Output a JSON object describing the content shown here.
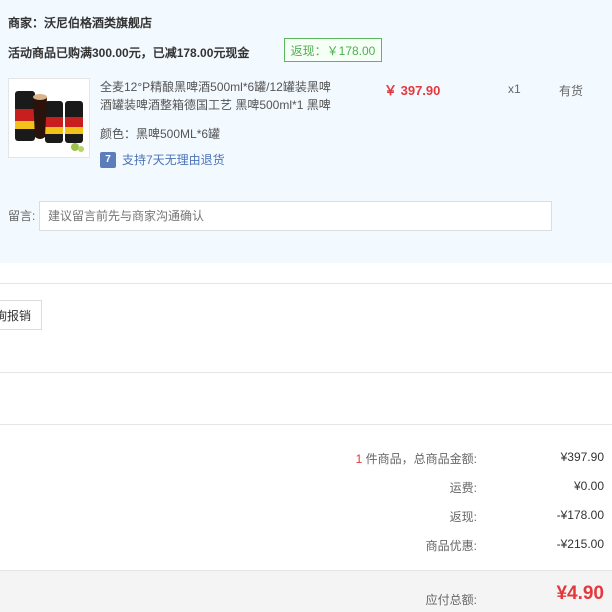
{
  "order": {
    "seller_prefix": "商家：",
    "seller_name": "沃尼伯格酒类旗舰店",
    "promo_text": "活动商品已购满300.00元，已减178.00元现金",
    "cashback_tag": "返现：￥178.00",
    "item": {
      "image_icon": "beer-can-pack",
      "title": "全麦12°P精酿黑啤酒500ml*6罐/12罐装黑啤酒罐装啤酒整箱德国工艺 黑啤500ml*1 黑啤",
      "price": "￥ 397.90",
      "quantity": "x1",
      "stock": "有货",
      "color": "颜色：黑啤500ML*6罐",
      "return_badge": "7",
      "return_policy": "支持7天无理由退货"
    },
    "message_label": "留言:",
    "message_placeholder": "建议留言前先与商家沟通确认"
  },
  "invoice_button_label": "询报销",
  "summary": {
    "count": "1",
    "count_suffix": " 件商品，总商品金额:",
    "total_goods": "¥397.90",
    "shipping_label": "运费:",
    "shipping": "¥0.00",
    "cashback_label": "返现:",
    "cashback": "-¥178.00",
    "discount_label": "商品优惠:",
    "discount": "-¥215.00",
    "payable_label": "应付总额:",
    "payable": "¥4.90"
  },
  "colors": {
    "price_red": "#e4393c",
    "panel_bg": "#f2f9ff",
    "cashback_green": "#4caf50",
    "link_blue": "#4b73b6"
  }
}
